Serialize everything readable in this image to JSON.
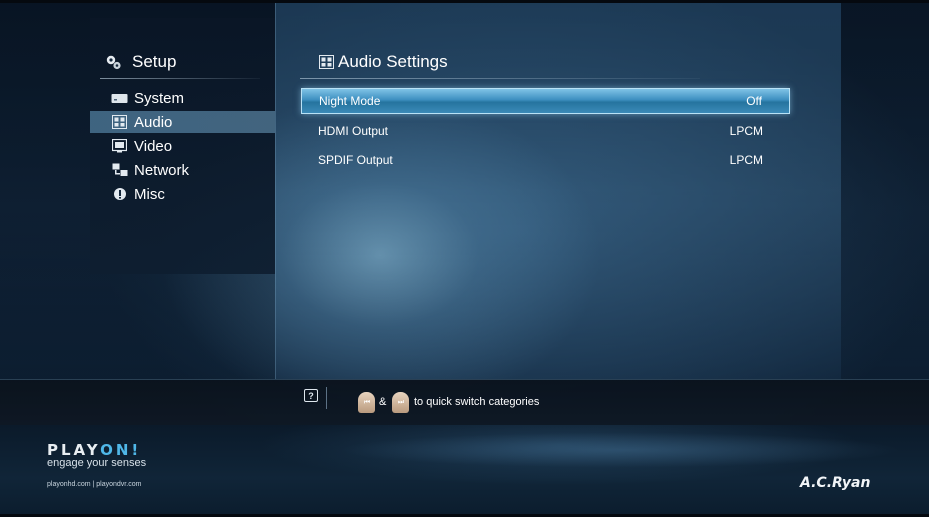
{
  "sidebar": {
    "title": "Setup",
    "title_icon": "gears-icon",
    "items": [
      {
        "label": "System",
        "icon": "system-icon"
      },
      {
        "label": "Audio",
        "icon": "audio-icon",
        "active": true
      },
      {
        "label": "Video",
        "icon": "video-icon"
      },
      {
        "label": "Network",
        "icon": "network-icon"
      },
      {
        "label": "Misc",
        "icon": "info-icon"
      }
    ]
  },
  "main": {
    "title": "Audio Settings",
    "title_icon": "audio-icon",
    "settings": [
      {
        "label": "Night Mode",
        "value": "Off",
        "selected": true
      },
      {
        "label": "HDMI Output",
        "value": "LPCM"
      },
      {
        "label": "SPDIF Output",
        "value": "LPCM"
      }
    ]
  },
  "hint": {
    "help_glyph": "?",
    "prev_glyph": "⏮",
    "next_glyph": "⏭",
    "amp": "&",
    "text": "to quick switch categories"
  },
  "footer": {
    "brand_main": "PLAY",
    "brand_accent": "ON!",
    "tagline": "engage your senses",
    "links": "playonhd.com | playondvr.com",
    "maker": "A.C.Ryan"
  },
  "colors": {
    "selection": "#3d8fc0",
    "brand_accent": "#4fb7e8"
  }
}
